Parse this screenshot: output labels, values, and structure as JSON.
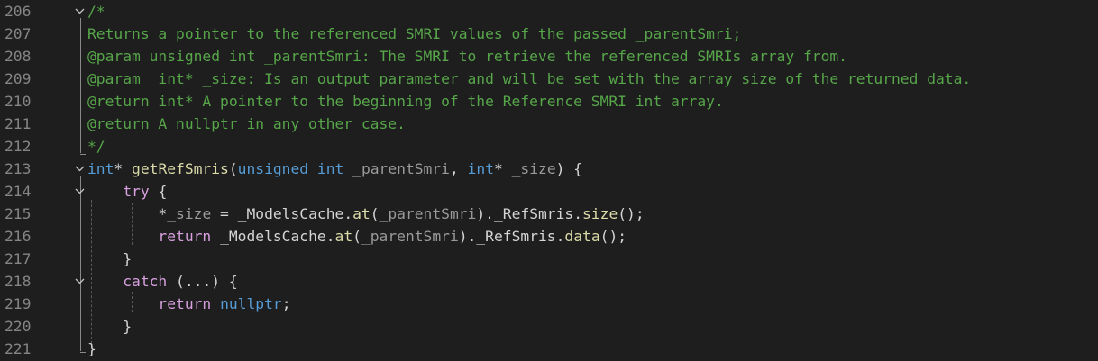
{
  "editor": {
    "lines": [
      {
        "num": "206",
        "fold": "v",
        "parts": [
          {
            "t": "/*",
            "c": "cm"
          }
        ]
      },
      {
        "num": "207",
        "fold": "",
        "parts": [
          {
            "t": "Returns a pointer to the referenced SMRI values of the passed _parentSmri;",
            "c": "cm"
          }
        ]
      },
      {
        "num": "208",
        "fold": "",
        "parts": [
          {
            "t": "@param unsigned int _parentSmri: The SMRI to retrieve the referenced SMRIs array from.",
            "c": "cm"
          }
        ]
      },
      {
        "num": "209",
        "fold": "",
        "parts": [
          {
            "t": "@param  int* _size: Is an output parameter and will be set with the array size of the returned data.",
            "c": "cm"
          }
        ]
      },
      {
        "num": "210",
        "fold": "",
        "parts": [
          {
            "t": "@return int* A pointer to the beginning of the Reference SMRI int array.",
            "c": "cm"
          }
        ]
      },
      {
        "num": "211",
        "fold": "",
        "parts": [
          {
            "t": "@return A nullptr in any other case.",
            "c": "cm"
          }
        ]
      },
      {
        "num": "212",
        "fold": "",
        "parts": [
          {
            "t": "*/",
            "c": "cm"
          }
        ]
      },
      {
        "num": "213",
        "fold": "v",
        "parts": [
          {
            "t": "int",
            "c": "kw"
          },
          {
            "t": "* ",
            "c": "tx"
          },
          {
            "t": "getRefSmris",
            "c": "fn"
          },
          {
            "t": "(",
            "c": "tx"
          },
          {
            "t": "unsigned",
            "c": "kw"
          },
          {
            "t": " ",
            "c": "tx"
          },
          {
            "t": "int",
            "c": "kw"
          },
          {
            "t": " ",
            "c": "tx"
          },
          {
            "t": "_parentSmri",
            "c": "pm"
          },
          {
            "t": ", ",
            "c": "tx"
          },
          {
            "t": "int",
            "c": "kw"
          },
          {
            "t": "* ",
            "c": "tx"
          },
          {
            "t": "_size",
            "c": "pm"
          },
          {
            "t": ") {",
            "c": "tx"
          }
        ]
      },
      {
        "num": "214",
        "fold": "v",
        "parts": [
          {
            "t": "    ",
            "c": "tx"
          },
          {
            "t": "try",
            "c": "ctl"
          },
          {
            "t": " {",
            "c": "tx"
          }
        ]
      },
      {
        "num": "215",
        "fold": "",
        "parts": [
          {
            "t": "        *",
            "c": "tx"
          },
          {
            "t": "_size",
            "c": "pm"
          },
          {
            "t": " = ",
            "c": "tx"
          },
          {
            "t": "_ModelsCache",
            "c": "mb"
          },
          {
            "t": ".",
            "c": "tx"
          },
          {
            "t": "at",
            "c": "fn"
          },
          {
            "t": "(",
            "c": "tx"
          },
          {
            "t": "_parentSmri",
            "c": "pm"
          },
          {
            "t": ").",
            "c": "tx"
          },
          {
            "t": "_RefSmris",
            "c": "mb"
          },
          {
            "t": ".",
            "c": "tx"
          },
          {
            "t": "size",
            "c": "fn"
          },
          {
            "t": "();",
            "c": "tx"
          }
        ]
      },
      {
        "num": "216",
        "fold": "",
        "parts": [
          {
            "t": "        ",
            "c": "tx"
          },
          {
            "t": "return",
            "c": "ctl"
          },
          {
            "t": " ",
            "c": "tx"
          },
          {
            "t": "_ModelsCache",
            "c": "mb"
          },
          {
            "t": ".",
            "c": "tx"
          },
          {
            "t": "at",
            "c": "fn"
          },
          {
            "t": "(",
            "c": "tx"
          },
          {
            "t": "_parentSmri",
            "c": "pm"
          },
          {
            "t": ").",
            "c": "tx"
          },
          {
            "t": "_RefSmris",
            "c": "mb"
          },
          {
            "t": ".",
            "c": "tx"
          },
          {
            "t": "data",
            "c": "fn"
          },
          {
            "t": "();",
            "c": "tx"
          }
        ]
      },
      {
        "num": "217",
        "fold": "",
        "parts": [
          {
            "t": "    }",
            "c": "tx"
          }
        ]
      },
      {
        "num": "218",
        "fold": "v",
        "parts": [
          {
            "t": "    ",
            "c": "tx"
          },
          {
            "t": "catch",
            "c": "ctl"
          },
          {
            "t": " (...) {",
            "c": "tx"
          }
        ]
      },
      {
        "num": "219",
        "fold": "",
        "parts": [
          {
            "t": "        ",
            "c": "tx"
          },
          {
            "t": "return",
            "c": "ctl"
          },
          {
            "t": " ",
            "c": "tx"
          },
          {
            "t": "nullptr",
            "c": "kw"
          },
          {
            "t": ";",
            "c": "tx"
          }
        ]
      },
      {
        "num": "220",
        "fold": "",
        "parts": [
          {
            "t": "    }",
            "c": "tx"
          }
        ]
      },
      {
        "num": "221",
        "fold": "",
        "parts": [
          {
            "t": "}",
            "c": "tx"
          }
        ]
      }
    ]
  },
  "colors": {
    "background": "#1e1e1e",
    "line_number": "#858585",
    "comment": "#57a64a",
    "keyword": "#569cd6",
    "control": "#d8a0df",
    "function": "#dcdcaa",
    "parameter": "#9a9a9a",
    "text": "#d4d4d4"
  },
  "icons": {
    "fold": "chevron-down-icon"
  }
}
